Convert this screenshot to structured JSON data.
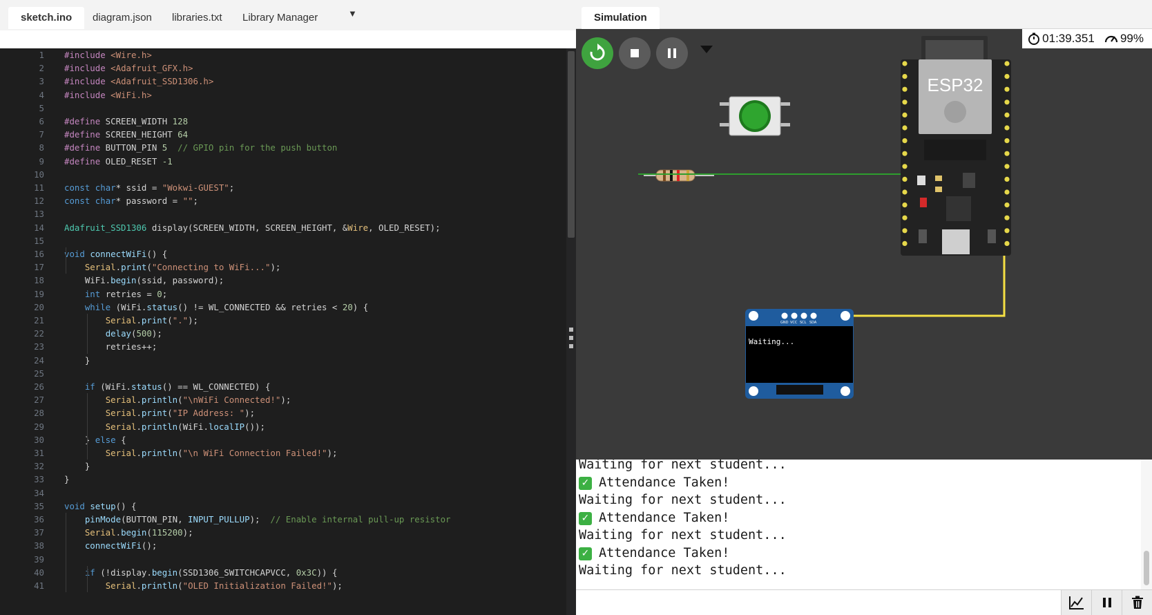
{
  "editor": {
    "tabs": [
      "sketch.ino",
      "diagram.json",
      "libraries.txt",
      "Library Manager"
    ],
    "menu_icon": "triangle-down-icon"
  },
  "code_lines": [
    "#include <Wire.h>",
    "#include <Adafruit_GFX.h>",
    "#include <Adafruit_SSD1306.h>",
    "#include <WiFi.h>",
    "",
    "#define SCREEN_WIDTH 128",
    "#define SCREEN_HEIGHT 64",
    "#define BUTTON_PIN 5  // GPIO pin for the push button",
    "#define OLED_RESET -1",
    "",
    "const char* ssid = \"Wokwi-GUEST\";",
    "const char* password = \"\";",
    "",
    "Adafruit_SSD1306 display(SCREEN_WIDTH, SCREEN_HEIGHT, &Wire, OLED_RESET);",
    "",
    "void connectWiFi() {",
    "    Serial.print(\"Connecting to WiFi...\");",
    "    WiFi.begin(ssid, password);",
    "    int retries = 0;",
    "    while (WiFi.status() != WL_CONNECTED && retries < 20) {",
    "        Serial.print(\".\");",
    "        delay(500);",
    "        retries++;",
    "    }",
    "",
    "    if (WiFi.status() == WL_CONNECTED) {",
    "        Serial.println(\"\\nWiFi Connected!\");",
    "        Serial.print(\"IP Address: \");",
    "        Serial.println(WiFi.localIP());",
    "    } else {",
    "        Serial.println(\"\\n WiFi Connection Failed!\");",
    "    }",
    "}",
    "",
    "void setup() {",
    "    pinMode(BUTTON_PIN, INPUT_PULLUP);  // Enable internal pull-up resistor",
    "    Serial.begin(115200);",
    "    connectWiFi();",
    "",
    "    if (!display.begin(SSD1306_SWITCHCAPVCC, 0x3C)) {",
    "        Serial.println(\"OLED Initialization Failed!\");"
  ],
  "simulation": {
    "tab_label": "Simulation",
    "timer": "01:39.351",
    "speed": "99%",
    "controls": [
      "restart-icon",
      "stop-icon",
      "pause-icon"
    ],
    "accent": "#3fa33f",
    "board_label": "ESP32",
    "oled_text": "Waiting...",
    "oled_pins": [
      "GND",
      "VCC",
      "SCL",
      "SDA"
    ],
    "wire_colors": {
      "button_wire": "#2e9e2e",
      "sda_wire": "#f5e043"
    }
  },
  "serial": {
    "lines": [
      {
        "text": "Waiting for next student...",
        "check": false
      },
      {
        "text": "Attendance Taken!",
        "check": true
      },
      {
        "text": "Waiting for next student...",
        "check": false
      },
      {
        "text": "Attendance Taken!",
        "check": true
      },
      {
        "text": "Waiting for next student...",
        "check": false
      },
      {
        "text": "Attendance Taken!",
        "check": true
      },
      {
        "text": "Waiting for next student...",
        "check": false
      }
    ],
    "check_glyph": "✓",
    "input_value": "",
    "buttons": [
      "plotter-icon",
      "pause-icon",
      "trash-icon"
    ]
  }
}
